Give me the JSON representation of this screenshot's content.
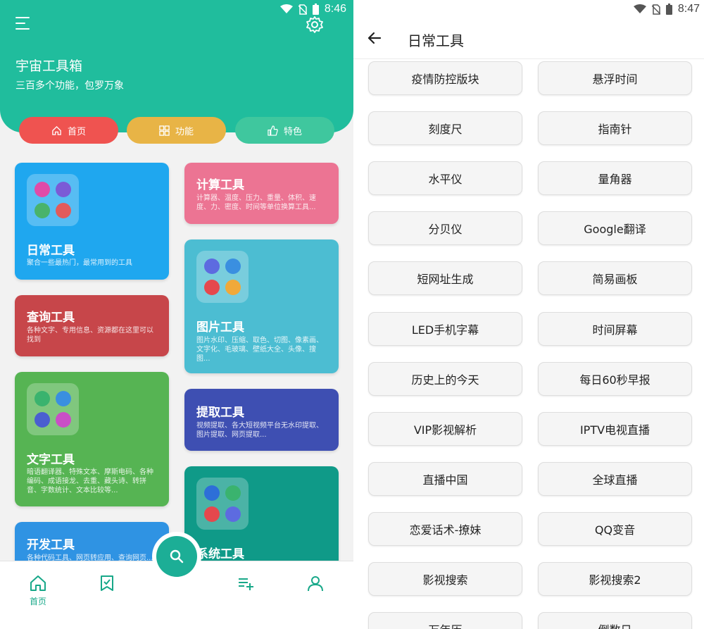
{
  "left": {
    "status": {
      "time": "8:46"
    },
    "header": {
      "title": "宇宙工具箱",
      "subtitle": "三百多个功能，包罗万象"
    },
    "pills": [
      {
        "label": "首页",
        "icon": "home-icon"
      },
      {
        "label": "功能",
        "icon": "grid-icon"
      },
      {
        "label": "特色",
        "icon": "thumb-up-icon"
      }
    ],
    "cards": {
      "daily": {
        "title": "日常工具",
        "desc": "聚合一些最热门，最常用到的工具"
      },
      "calc": {
        "title": "计算工具",
        "desc": "计算器、温度、压力、重量、体积、速度、力、密度、时间等单位换算工具..."
      },
      "query": {
        "title": "查询工具",
        "desc": "各种文字、专用信息、资源都在这里可以找到"
      },
      "image": {
        "title": "图片工具",
        "desc": "图片水印、压缩、取色、切图、像素画、文字化、毛玻璃、壁纸大全、头像、搜图..."
      },
      "text": {
        "title": "文字工具",
        "desc": "暗语翻译器、特殊文本、摩斯电码、各种编码、成语接龙、去重、藏头诗、转拼音、字数统计、文本比较等..."
      },
      "extract": {
        "title": "提取工具",
        "desc": "视频提取、各大短视频平台无水印提取、图片提取、网页提取..."
      },
      "dev": {
        "title": "开发工具",
        "desc": "各种代码工具、网页转应用、查询网页..."
      },
      "sys": {
        "title": "系统工具",
        "desc": ""
      }
    },
    "bottom_nav": {
      "home_label": "首页"
    }
  },
  "right": {
    "status": {
      "time": "8:47"
    },
    "title": "日常工具",
    "tools": [
      "疫情防控版块",
      "悬浮时间",
      "刻度尺",
      "指南针",
      "水平仪",
      "量角器",
      "分贝仪",
      "Google翻译",
      "短网址生成",
      "简易画板",
      "LED手机字幕",
      "时间屏幕",
      "历史上的今天",
      "每日60秒早报",
      "VIP影视解析",
      "IPTV电视直播",
      "直播中国",
      "全球直播",
      "恋爱话术-撩妹",
      "QQ变音",
      "影视搜索",
      "影视搜索2",
      "万年历",
      "倒数日"
    ]
  },
  "colors": {
    "brand": "#20bd9d",
    "pill_home": "#ef5350",
    "pill_func": "#e8b446",
    "pill_feat": "#3fc79e"
  }
}
